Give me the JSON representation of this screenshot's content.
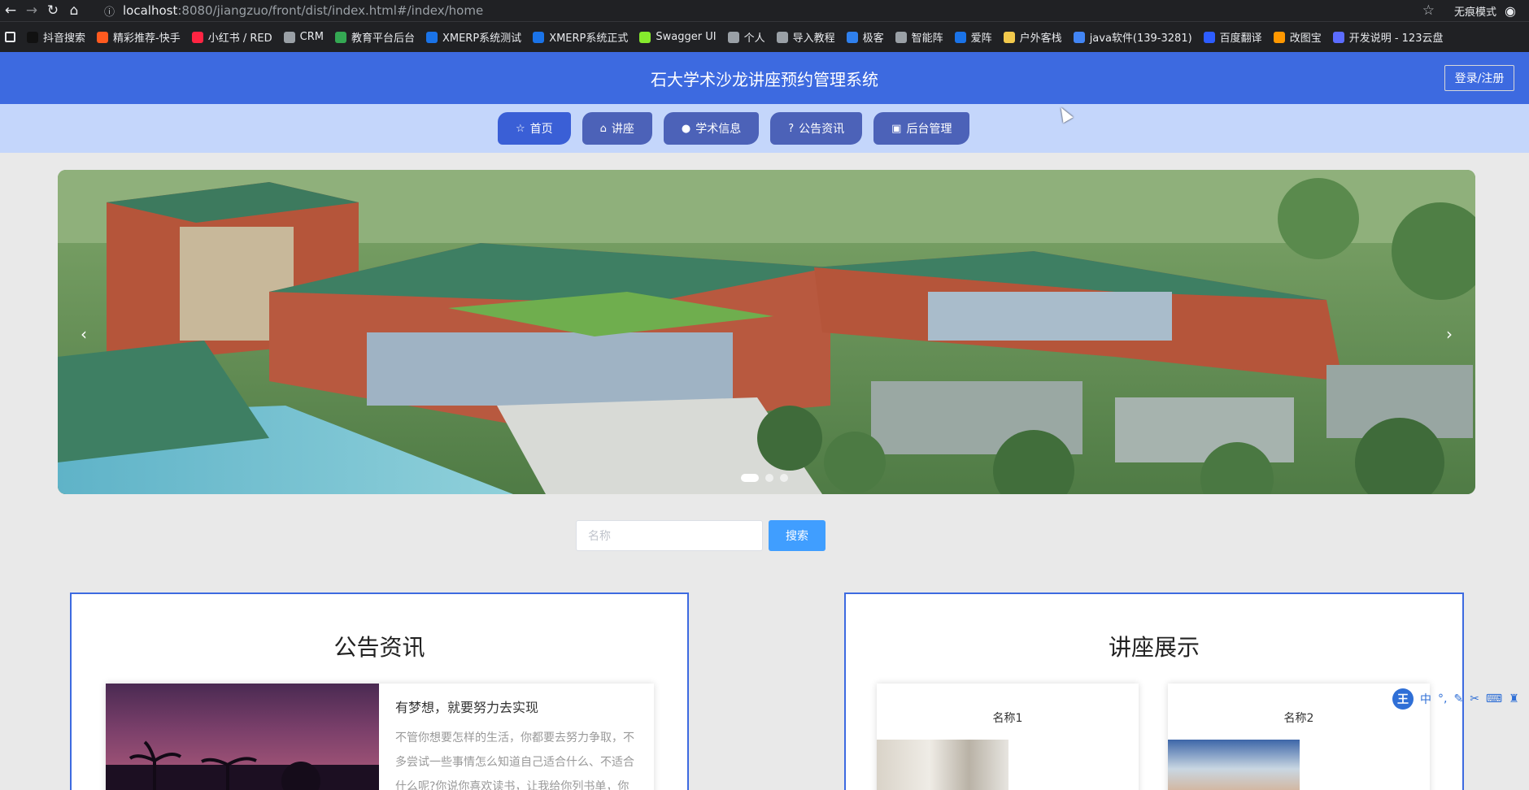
{
  "browser": {
    "url_host": "localhost",
    "url_rest": ":8080/jiangzuo/front/dist/index.html#/index/home",
    "incognito_label": "无痕模式",
    "bookmarks": [
      {
        "label": "抖音搜索",
        "color": "#111111"
      },
      {
        "label": "精彩推荐-快手",
        "color": "#ff5a1f"
      },
      {
        "label": "小红书 / RED",
        "color": "#ff2442"
      },
      {
        "label": "CRM",
        "color": "#9aa0a6"
      },
      {
        "label": "教育平台后台",
        "color": "#34a853"
      },
      {
        "label": "XMERP系统测试",
        "color": "#1a73e8"
      },
      {
        "label": "XMERP系统正式",
        "color": "#1a73e8"
      },
      {
        "label": "Swagger UI",
        "color": "#85ea2d"
      },
      {
        "label": "个人",
        "color": "#9aa0a6"
      },
      {
        "label": "导入教程",
        "color": "#9aa0a6"
      },
      {
        "label": "极客",
        "color": "#2f80ed"
      },
      {
        "label": "智能阵",
        "color": "#9aa0a6"
      },
      {
        "label": "爱阵",
        "color": "#1a73e8"
      },
      {
        "label": "户外客栈",
        "color": "#f2c94c"
      },
      {
        "label": "java软件(139-3281)",
        "color": "#4285f4"
      },
      {
        "label": "百度翻译",
        "color": "#2d5dff"
      },
      {
        "label": "改图宝",
        "color": "#ff9800"
      },
      {
        "label": "开发说明 - 123云盘",
        "color": "#5b6cff"
      }
    ]
  },
  "header": {
    "title": "石大学术沙龙讲座预约管理系统",
    "login_label": "登录/注册"
  },
  "nav": [
    {
      "label": "首页",
      "icon": "star-icon",
      "glyph": "☆"
    },
    {
      "label": "讲座",
      "icon": "bag-icon",
      "glyph": "⌂"
    },
    {
      "label": "学术信息",
      "icon": "info-icon",
      "glyph": "●"
    },
    {
      "label": "公告资讯",
      "icon": "question-icon",
      "glyph": "?"
    },
    {
      "label": "后台管理",
      "icon": "building-icon",
      "glyph": "▣"
    }
  ],
  "carousel": {
    "slide_count": 3,
    "active_index": 0,
    "prev_glyph": "‹",
    "next_glyph": "›"
  },
  "search": {
    "placeholder": "名称",
    "value": "",
    "button_label": "搜索"
  },
  "notice_panel": {
    "title": "公告资讯",
    "item_title": "有梦想，就要努力去实现",
    "item_text": "不管你想要怎样的生活，你都要去努力争取，不多尝试一些事情怎么知道自己适合什么、不适合什么呢?你说你喜欢读书，让我给你列书单，你"
  },
  "lecture_panel": {
    "title": "讲座展示",
    "items": [
      {
        "name": "名称1"
      },
      {
        "name": "名称2"
      }
    ]
  },
  "ime": {
    "badge": "王",
    "mode": "中"
  },
  "colors": {
    "primary": "#3d6ae0",
    "nav_bg": "#c4d6fb",
    "search_button": "#409eff"
  }
}
